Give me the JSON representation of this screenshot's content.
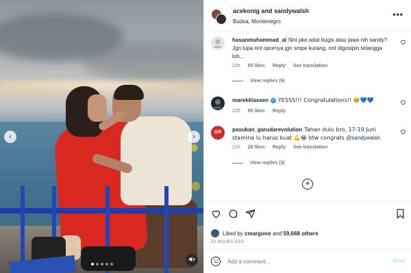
{
  "post": {
    "authors": "acekonig and sandywalsh",
    "location": "Budva, Montenegro",
    "more_label": "•••"
  },
  "media": {
    "prev_label": "‹",
    "next_label": "›",
    "slide_count": 5,
    "active_slide": 1,
    "mute_label": "🔇"
  },
  "comments": [
    {
      "user": "hasanmuhammad_al",
      "text": "Nnt pke adat bugis atau jawa nih sandy? Jgn lupa nnt opornya jgn smpe kurang, nnt digosipin tetangga loh...",
      "time": "22h",
      "likes": "55 likes",
      "reply": "Reply",
      "translate": "See translation",
      "view_replies": "View replies (6)",
      "avatar_color": "#e5e5e5"
    },
    {
      "user": "marekklassen",
      "verified": true,
      "text": "YESSS!!! Congratulations!! 🥹💙💙",
      "time": "22h",
      "likes": "85 likes",
      "reply": "Reply",
      "avatar_color": "#1d2a33"
    },
    {
      "user": "pasukan_garudarevolution",
      "text_before": "Tahan dulu bro, 17-19 Juni stamina lu harus kuat 💪😂 btw congrats ",
      "mention": "@sandywalsh",
      "time": "21h",
      "likes": "28 likes",
      "reply": "Reply",
      "translate": "See translation",
      "view_replies": "View replies (3)",
      "avatar_color": "#d6282b",
      "avatar_text": "GR"
    }
  ],
  "load_more_label": "+",
  "actions": {
    "like_icon": "heart-icon",
    "comment_icon": "comment-icon",
    "share_icon": "share-icon",
    "save_icon": "bookmark-icon"
  },
  "liked_by": {
    "prefix": "Liked by ",
    "user": "cmargono",
    "middle": " and ",
    "others": "59,668 others"
  },
  "time_ago": "22 HOURS AGO",
  "add_comment": {
    "placeholder": "Add a comment...",
    "post_label": "Post"
  }
}
